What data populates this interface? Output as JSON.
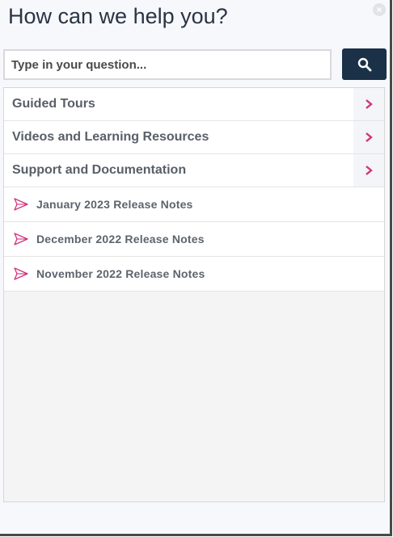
{
  "header": {
    "title": "How can we help you?"
  },
  "close": {
    "icon": "close-icon",
    "glyph": "×"
  },
  "search": {
    "placeholder": "Type in your question...",
    "value": "",
    "button_icon": "search-icon"
  },
  "nav_items": [
    {
      "label": "Guided Tours",
      "icon": "chevron-right-icon"
    },
    {
      "label": "Videos and Learning Resources",
      "icon": "chevron-right-icon"
    },
    {
      "label": "Support and Documentation",
      "icon": "chevron-right-icon"
    }
  ],
  "release_notes": [
    {
      "label": "January 2023 Release Notes",
      "icon": "paper-plane-icon"
    },
    {
      "label": "December 2022 Release Notes",
      "icon": "paper-plane-icon"
    },
    {
      "label": "November 2022 Release Notes",
      "icon": "paper-plane-icon"
    }
  ],
  "colors": {
    "accent": "#d2337a",
    "button": "#1b3147",
    "title": "#2a3443"
  }
}
